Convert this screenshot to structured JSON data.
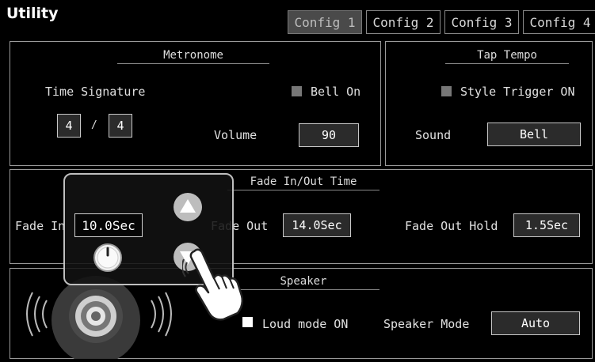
{
  "header": {
    "title": "Utility"
  },
  "tabs": [
    {
      "label": "Config 1"
    },
    {
      "label": "Config 2"
    },
    {
      "label": "Config 3"
    },
    {
      "label": "Config 4"
    }
  ],
  "metronome": {
    "title": "Metronome",
    "time_signature_label": "Time Signature",
    "numerator": "4",
    "slash": "/",
    "denominator": "4",
    "bell_label": "Bell On",
    "volume_label": "Volume",
    "volume_value": "90"
  },
  "tap_tempo": {
    "title": "Tap Tempo",
    "style_trigger_label": "Style Trigger ON",
    "sound_label": "Sound",
    "sound_value": "Bell"
  },
  "fade": {
    "title": "Fade In/Out Time",
    "fade_in_label": "Fade In",
    "fade_out_label": "Fade Out",
    "fade_out_value": "14.0Sec",
    "fade_out_hold_label": "Fade Out Hold",
    "fade_out_hold_value": "1.5Sec"
  },
  "speaker": {
    "title": "Speaker",
    "loud_mode_label": "Loud mode ON",
    "mode_label": "Speaker Mode",
    "mode_value": "Auto"
  },
  "popup": {
    "value": "10.0Sec"
  },
  "icons": {
    "up": "up-arrow-icon",
    "down": "down-arrow-icon",
    "knob": "knob-icon",
    "hand": "hand-pointer-icon",
    "speaker": "speaker-icon"
  }
}
